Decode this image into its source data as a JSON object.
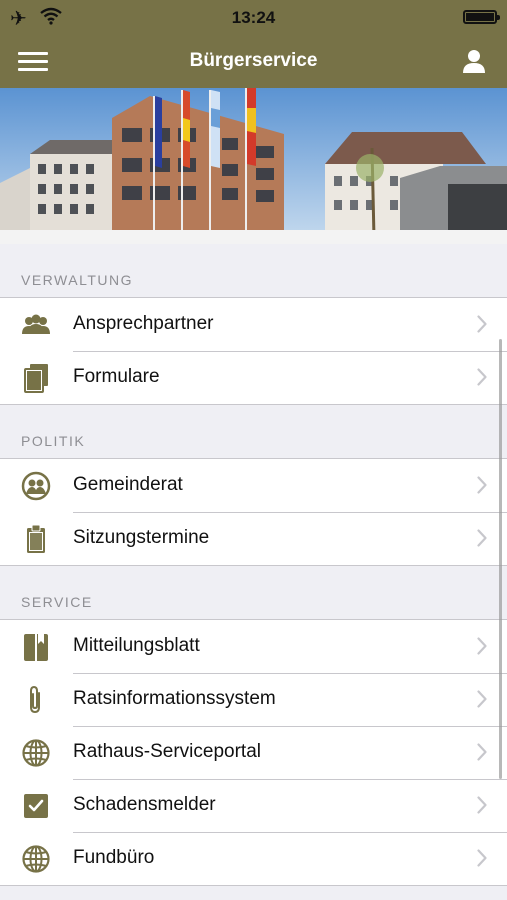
{
  "status_bar": {
    "time": "13:24"
  },
  "navbar": {
    "title": "Bürgerservice"
  },
  "colors": {
    "header": "#777247",
    "icon": "#777247"
  },
  "sections": [
    {
      "title": "VERWALTUNG",
      "items": [
        {
          "label": "Ansprechpartner",
          "icon": "people-icon"
        },
        {
          "label": "Formulare",
          "icon": "documents-icon"
        }
      ]
    },
    {
      "title": "POLITIK",
      "items": [
        {
          "label": "Gemeinderat",
          "icon": "group-circle-icon"
        },
        {
          "label": "Sitzungstermine",
          "icon": "clipboard-icon"
        }
      ]
    },
    {
      "title": "SERVICE",
      "items": [
        {
          "label": "Mitteilungsblatt",
          "icon": "book-icon"
        },
        {
          "label": "Ratsinformationssystem",
          "icon": "paperclip-icon"
        },
        {
          "label": "Rathaus-Serviceportal",
          "icon": "globe-icon"
        },
        {
          "label": "Schadensmelder",
          "icon": "checkbox-icon"
        },
        {
          "label": "Fundbüro",
          "icon": "globe-icon"
        }
      ]
    }
  ]
}
